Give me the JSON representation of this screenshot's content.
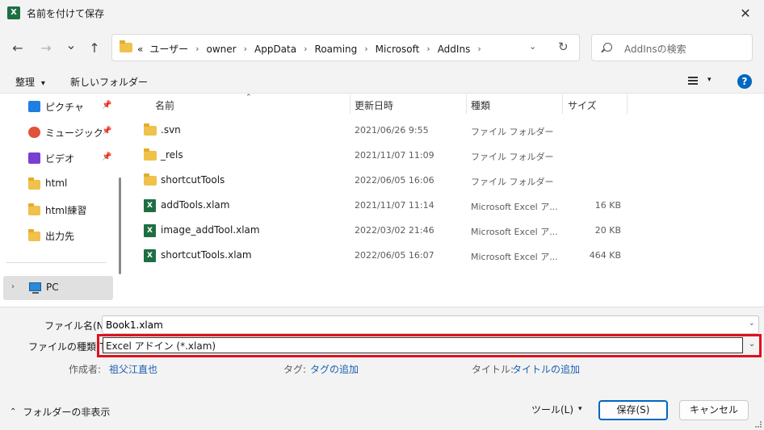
{
  "window": {
    "app_icon_text": "X",
    "title": "名前を付けて保存",
    "close_glyph": "✕"
  },
  "nav": {
    "back_glyph": "←",
    "forward_glyph": "→",
    "recent_glyph": "⌄",
    "up_glyph": "↑",
    "overflow": "«",
    "breadcrumbs": [
      "ユーザー",
      "owner",
      "AppData",
      "Roaming",
      "Microsoft",
      "AddIns"
    ],
    "separator": "›",
    "dropdown_glyph": "⌄",
    "refresh_glyph": "↻",
    "search_placeholder": "AddInsの検索"
  },
  "commands": {
    "organize": "整理",
    "organize_arrow": "▾",
    "new_folder": "新しいフォルダー",
    "view_arrow": "▾",
    "help": "?"
  },
  "sidebar": {
    "items": [
      {
        "label": "ピクチャ",
        "icon": "pictures-icon",
        "pinned": true
      },
      {
        "label": "ミュージック",
        "icon": "music-icon",
        "pinned": true
      },
      {
        "label": "ビデオ",
        "icon": "videos-icon",
        "pinned": true
      },
      {
        "label": "html",
        "icon": "folder-icon",
        "pinned": false
      },
      {
        "label": "html練習",
        "icon": "folder-icon",
        "pinned": false
      },
      {
        "label": "出力先",
        "icon": "folder-icon",
        "pinned": false
      }
    ],
    "pin_glyph": "📌",
    "pc_label": "PC",
    "pc_chevron": "›"
  },
  "columns": {
    "name": "名前",
    "modified": "更新日時",
    "type": "種類",
    "size": "サイズ",
    "sort_glyph": "⌃"
  },
  "files": [
    {
      "name": ".svn",
      "modified": "2021/06/26 9:55",
      "type": "ファイル フォルダー",
      "size": "",
      "kind": "folder"
    },
    {
      "name": "_rels",
      "modified": "2021/11/07 11:09",
      "type": "ファイル フォルダー",
      "size": "",
      "kind": "folder"
    },
    {
      "name": "shortcutTools",
      "modified": "2022/06/05 16:06",
      "type": "ファイル フォルダー",
      "size": "",
      "kind": "folder"
    },
    {
      "name": "addTools.xlam",
      "modified": "2021/11/07 11:14",
      "type": "Microsoft Excel ア...",
      "size": "16 KB",
      "kind": "xlam"
    },
    {
      "name": "image_addTool.xlam",
      "modified": "2022/03/02 21:46",
      "type": "Microsoft Excel ア...",
      "size": "20 KB",
      "kind": "xlam"
    },
    {
      "name": "shortcutTools.xlam",
      "modified": "2022/06/05 16:07",
      "type": "Microsoft Excel ア...",
      "size": "464 KB",
      "kind": "xlam"
    }
  ],
  "save_form": {
    "filename_label": "ファイル名(N):",
    "filename_value": "Book1.xlam",
    "filetype_label": "ファイルの種類(T):",
    "filetype_value": "Excel アドイン (*.xlam)",
    "dropdown_glyph": "⌄",
    "author_label": "作成者:",
    "author_value": "祖父江直也",
    "tags_label": "タグ:",
    "tags_value": "タグの追加",
    "title_label": "タイトル:",
    "title_value": "タイトルの追加"
  },
  "footer": {
    "hide_folders": "フォルダーの非表示",
    "hide_chevron": "⌃",
    "tools": "ツール(L)",
    "tools_arrow": "▾",
    "save": "保存(S)",
    "cancel": "キャンセル"
  },
  "colors": {
    "highlight": "#e0101e",
    "accent": "#0067c0",
    "excel_green": "#1d6f42",
    "folder_yellow": "#f0c14b"
  }
}
